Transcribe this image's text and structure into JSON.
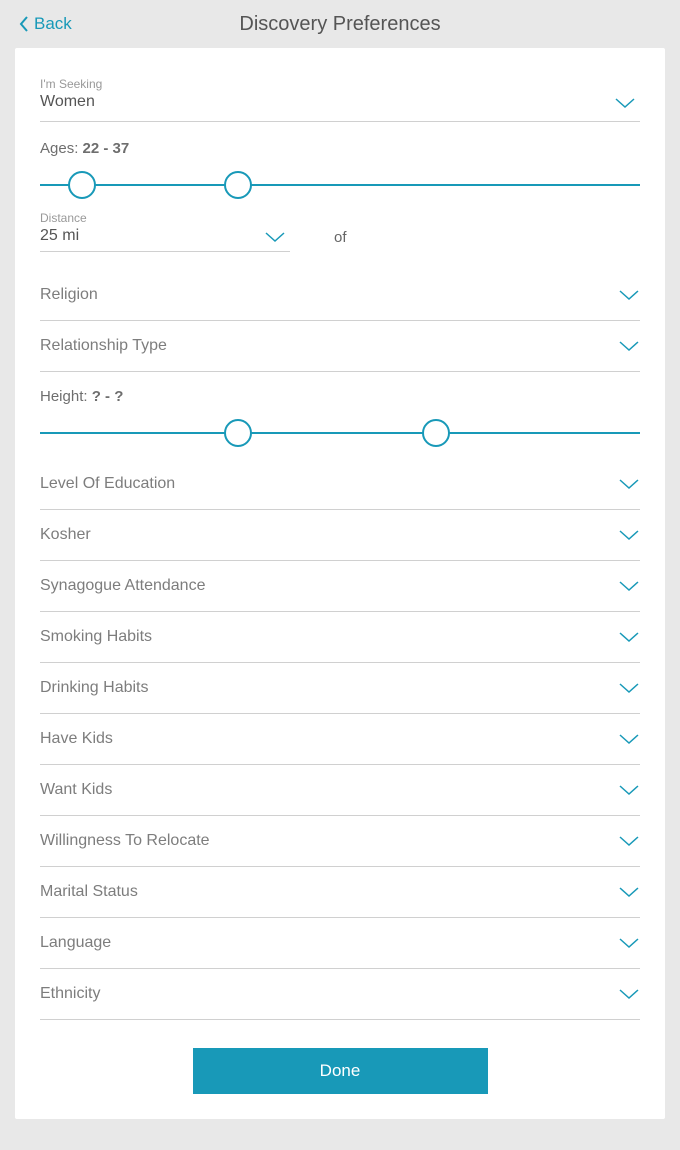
{
  "header": {
    "back_label": "Back",
    "title": "Discovery Preferences"
  },
  "seeking": {
    "label": "I'm Seeking",
    "value": "Women"
  },
  "ages": {
    "label": "Ages:",
    "value": "22 - 37",
    "min_pct": 7,
    "max_pct": 33
  },
  "distance": {
    "label": "Distance",
    "value": "25 mi",
    "of_text": "of"
  },
  "height": {
    "label": "Height:",
    "value": "? - ?",
    "min_pct": 33,
    "max_pct": 66
  },
  "prefs": [
    {
      "key": "religion",
      "label": "Religion"
    },
    {
      "key": "relationship-type",
      "label": "Relationship Type"
    }
  ],
  "prefs2": [
    {
      "key": "education",
      "label": "Level Of Education"
    },
    {
      "key": "kosher",
      "label": "Kosher"
    },
    {
      "key": "synagogue",
      "label": "Synagogue Attendance"
    },
    {
      "key": "smoking",
      "label": "Smoking Habits"
    },
    {
      "key": "drinking",
      "label": "Drinking Habits"
    },
    {
      "key": "have-kids",
      "label": "Have Kids"
    },
    {
      "key": "want-kids",
      "label": "Want Kids"
    },
    {
      "key": "relocate",
      "label": "Willingness To Relocate"
    },
    {
      "key": "marital",
      "label": "Marital Status"
    },
    {
      "key": "language",
      "label": "Language"
    },
    {
      "key": "ethnicity",
      "label": "Ethnicity"
    }
  ],
  "done_label": "Done",
  "colors": {
    "accent": "#1899b8"
  }
}
